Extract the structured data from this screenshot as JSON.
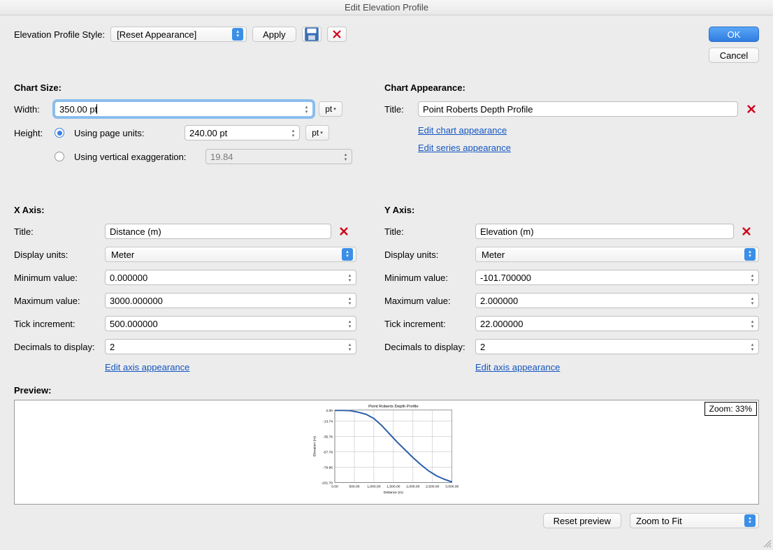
{
  "window": {
    "title": "Edit Elevation Profile"
  },
  "buttons": {
    "ok": "OK",
    "cancel": "Cancel",
    "apply": "Apply",
    "reset_preview": "Reset preview"
  },
  "style_row": {
    "label": "Elevation Profile Style:",
    "value": "[Reset Appearance]"
  },
  "chart_size": {
    "heading": "Chart Size:",
    "width_label": "Width:",
    "width_value": "350.00 pt",
    "width_unit": "pt",
    "height_label": "Height:",
    "radio_page_units": "Using page units:",
    "height_value": "240.00 pt",
    "height_unit": "pt",
    "radio_vert_exag": "Using vertical exaggeration:",
    "vert_exag_value": "19.84"
  },
  "chart_appearance": {
    "heading": "Chart Appearance:",
    "title_label": "Title:",
    "title_value": "Point Roberts Depth Profile",
    "link_chart": "Edit chart appearance",
    "link_series": "Edit series appearance"
  },
  "x_axis": {
    "heading": "X Axis:",
    "title_label": "Title:",
    "title_value": "Distance (m)",
    "display_units_label": "Display units:",
    "display_units_value": "Meter",
    "min_label": "Minimum value:",
    "min_value": "0.000000",
    "max_label": "Maximum value:",
    "max_value": "3000.000000",
    "tick_label": "Tick increment:",
    "tick_value": "500.000000",
    "dec_label": "Decimals to display:",
    "dec_value": "2",
    "link": "Edit axis appearance"
  },
  "y_axis": {
    "heading": "Y Axis:",
    "title_label": "Title:",
    "title_value": "Elevation (m)",
    "display_units_label": "Display units:",
    "display_units_value": "Meter",
    "min_label": "Minimum value:",
    "min_value": "-101.700000",
    "max_label": "Maximum value:",
    "max_value": "2.000000",
    "tick_label": "Tick increment:",
    "tick_value": "22.000000",
    "dec_label": "Decimals to display:",
    "dec_value": "2",
    "link": "Edit axis appearance"
  },
  "preview": {
    "heading": "Preview:",
    "zoom_label": "Zoom: 33%",
    "zoom_select": "Zoom to Fit"
  },
  "chart_data": {
    "type": "line",
    "title": "Point Roberts Depth Profile",
    "xlabel": "Distance (m)",
    "ylabel": "Elevation (m)",
    "xlim": [
      0,
      3000
    ],
    "ylim": [
      -101.7,
      2.0
    ],
    "xticks": [
      0,
      500,
      1000,
      1500,
      2000,
      2500,
      3000
    ],
    "yticks": [
      -101.7,
      -79.96,
      -57.78,
      -35.76,
      -13.74,
      2.0
    ],
    "x": [
      0,
      200,
      400,
      600,
      800,
      1000,
      1200,
      1400,
      1600,
      1800,
      2000,
      2200,
      2400,
      2600,
      2800,
      3000
    ],
    "y": [
      1.5,
      1.5,
      1.2,
      -1,
      -4,
      -10,
      -20,
      -32,
      -44,
      -55,
      -66,
      -76,
      -85,
      -92,
      -97,
      -101
    ]
  }
}
